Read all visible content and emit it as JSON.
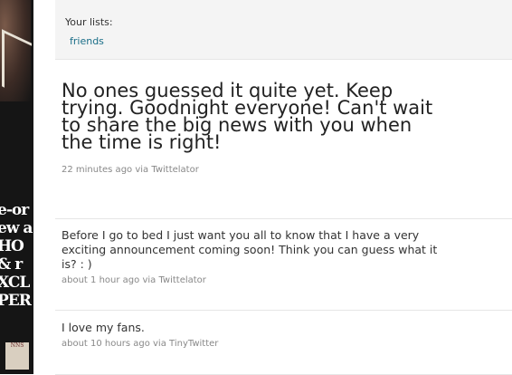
{
  "sidebar_lists": {
    "title": "Your lists:",
    "items": [
      {
        "label": "friends"
      }
    ]
  },
  "tweets": [
    {
      "text": "No ones guessed it quite yet. Keep trying. Goodnight everyone! Can't wait to share the big news with you when the time is right!",
      "time": "22 minutes ago",
      "via_prefix": "via",
      "source": "Twittelator"
    },
    {
      "text": "Before I go to bed I just want you all to know that I have a very exciting announcement coming soon! Think you can guess what it is? : )",
      "time": "about 1 hour ago",
      "via_prefix": "via",
      "source": "Twittelator"
    },
    {
      "text": "I love my fans.",
      "time": "about 10 hours ago",
      "via_prefix": "via",
      "source": "TinyTwitter"
    }
  ],
  "background_poster": {
    "lines": [
      "e-or",
      "ew a",
      "HO",
      "& r",
      "XCL",
      "PER"
    ],
    "stamp": "NNS"
  },
  "colors": {
    "link": "#1a6e88",
    "meta": "#888888",
    "panel": "#f4f4f4"
  }
}
